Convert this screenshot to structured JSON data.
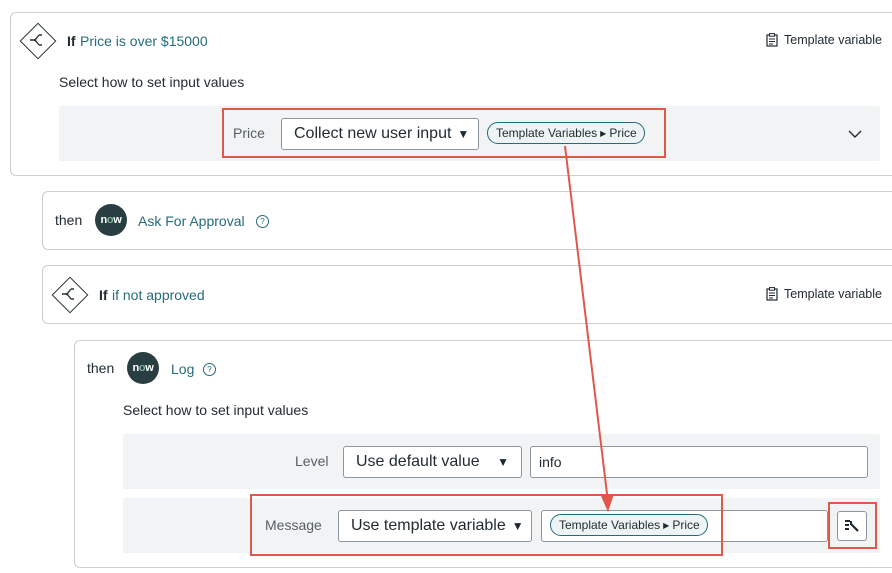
{
  "flow": {
    "if1": {
      "keyword": "If",
      "condition": "Price is over $15000",
      "template_var_button": "Template variable",
      "section_label": "Select how to set input values",
      "input": {
        "label": "Price",
        "mode": "Collect new user input",
        "pill": {
          "part1": "Template Variables",
          "part2": "Price"
        }
      }
    },
    "then1": {
      "keyword": "then",
      "logo_text": "now",
      "action": "Ask For Approval",
      "help": "?"
    },
    "if2": {
      "keyword": "If",
      "condition": "if not approved",
      "template_var_button": "Template variable"
    },
    "then2": {
      "keyword": "then",
      "logo_text": "now",
      "action": "Log",
      "help": "?",
      "section_label": "Select how to set input values",
      "level": {
        "label": "Level",
        "mode": "Use default value",
        "value": "info"
      },
      "message": {
        "label": "Message",
        "mode": "Use template variable",
        "pill": {
          "part1": "Template Variables",
          "part2": "Price"
        }
      }
    }
  },
  "colors": {
    "accent_link": "#266b7b",
    "highlight_red": "#e0584b",
    "row_background": "#f2f3f4",
    "now_logo_bg": "#293e40"
  },
  "icons": [
    "flow-branch-icon",
    "clipboard-icon",
    "chevron-down-icon",
    "help-circle-icon",
    "data-picker-icon",
    "caret-down-icon",
    "arrow-connector"
  ]
}
